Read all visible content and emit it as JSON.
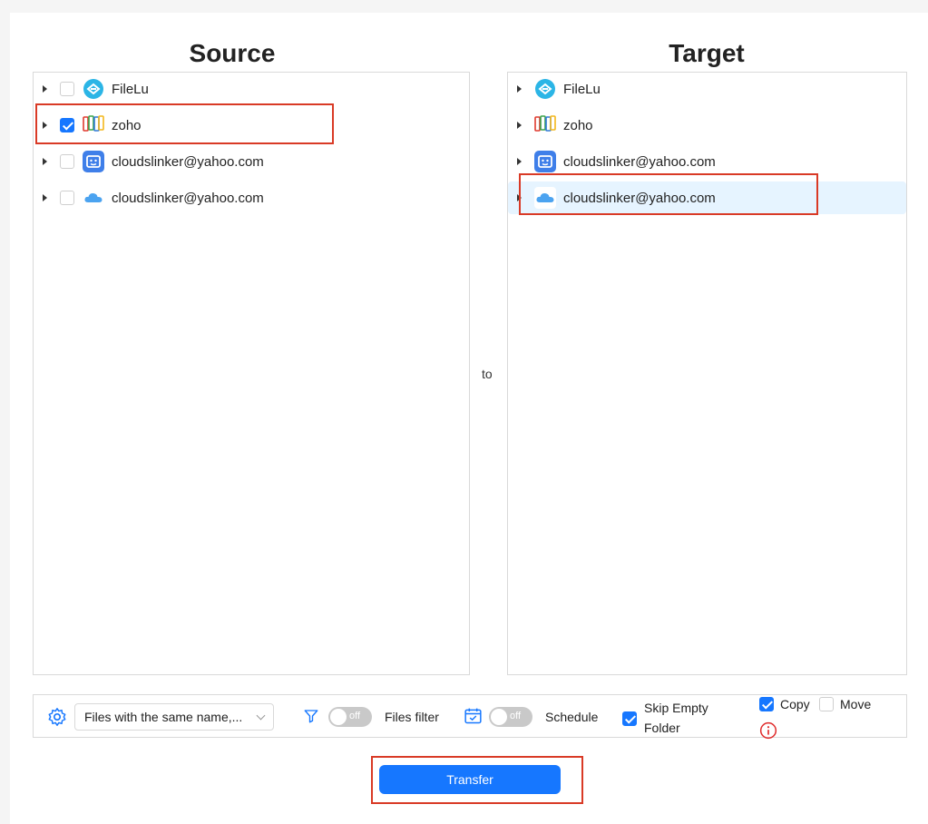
{
  "source": {
    "title": "Source",
    "items": [
      {
        "label": "FileLu",
        "icon": "filelu-icon",
        "checked": false
      },
      {
        "label": "zoho",
        "icon": "zoho-icon",
        "checked": true
      },
      {
        "label": "cloudslinker@yahoo.com",
        "icon": "yahoo-mail-icon",
        "checked": false
      },
      {
        "label": "cloudslinker@yahoo.com",
        "icon": "icloud-icon",
        "checked": false
      }
    ]
  },
  "target": {
    "title": "Target",
    "items": [
      {
        "label": "FileLu",
        "icon": "filelu-icon"
      },
      {
        "label": "zoho",
        "icon": "zoho-icon"
      },
      {
        "label": "cloudslinker@yahoo.com",
        "icon": "yahoo-mail-icon"
      },
      {
        "label": "cloudslinker@yahoo.com",
        "icon": "icloud-icon",
        "selected": true
      }
    ]
  },
  "connector_label": "to",
  "options": {
    "conflict_select_value": "Files with the same name,...",
    "files_filter_toggle": "off",
    "files_filter_label": "Files filter",
    "schedule_toggle": "off",
    "schedule_label": "Schedule",
    "skip_empty_label_line1": "Skip Empty",
    "skip_empty_label_line2": "Folder",
    "skip_empty_checked": true,
    "copy_label": "Copy",
    "copy_checked": true,
    "move_label": "Move",
    "move_checked": false
  },
  "transfer_button": "Transfer",
  "colors": {
    "accent": "#1677ff",
    "highlight_border": "#d93a26",
    "selected_row": "#e6f4ff"
  }
}
